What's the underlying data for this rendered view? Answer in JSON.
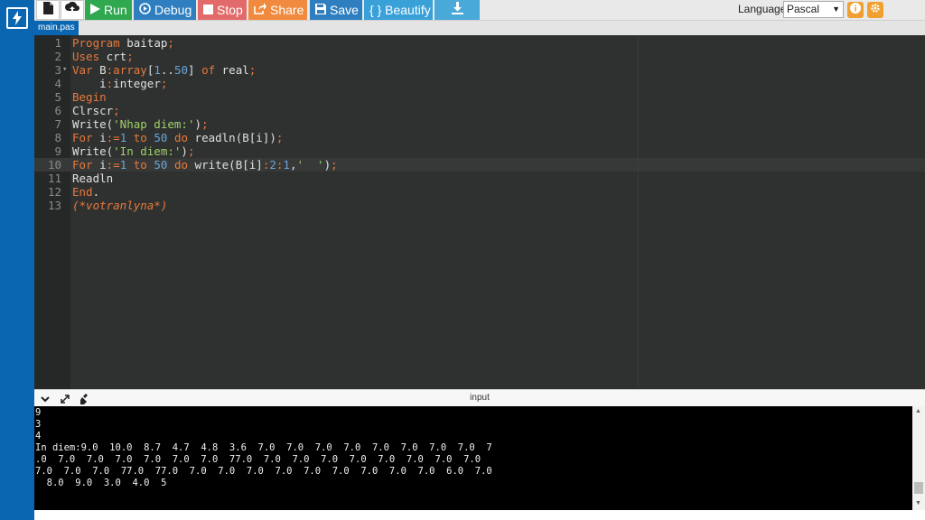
{
  "toolbar": {
    "run_label": "Run",
    "debug_label": "Debug",
    "stop_label": "Stop",
    "share_label": "Share",
    "save_label": "Save",
    "beautify_label": "{ } Beautify",
    "language_label": "Language",
    "language_value": "Pascal",
    "colors": {
      "run": "#2fa84f",
      "debug": "#2f7fc0",
      "stop": "#e36a6a",
      "share": "#f08a3e",
      "save": "#2f7fc0",
      "beautify": "#3aa0d8",
      "download": "#49a9d8",
      "round": "#f0a030"
    },
    "icons": [
      "new-file-icon",
      "upload-icon",
      "play-icon",
      "debug-icon",
      "stop-icon",
      "share-icon",
      "save-icon",
      "download-icon",
      "info-icon",
      "gear-icon"
    ]
  },
  "file_tab": "main.pas",
  "editor": {
    "active_line": 10,
    "lines": [
      {
        "n": "1",
        "fold": "",
        "html": "<span class='kw'>Program</span> baitap<span class='op'>;</span>"
      },
      {
        "n": "2",
        "fold": "",
        "html": "<span class='kw'>Uses</span> crt<span class='op'>;</span>"
      },
      {
        "n": "3",
        "fold": "▾",
        "html": "<span class='kw'>Var</span> B<span class='op'>:</span><span class='kw'>array</span>[<span class='nm'>1</span>..<span class='nm'>50</span>] <span class='kw'>of</span> real<span class='op'>;</span>"
      },
      {
        "n": "4",
        "fold": "",
        "html": "    i<span class='op'>:</span>integer<span class='op'>;</span>"
      },
      {
        "n": "5",
        "fold": "",
        "html": "<span class='kw'>Begin</span>"
      },
      {
        "n": "6",
        "fold": "",
        "html": "Clrscr<span class='op'>;</span>"
      },
      {
        "n": "7",
        "fold": "",
        "html": "Write(<span class='st'>'Nhap diem:'</span>)<span class='op'>;</span>"
      },
      {
        "n": "8",
        "fold": "",
        "html": "<span class='kw'>For</span> i<span class='op'>:=</span><span class='nm'>1</span> <span class='kw'>to</span> <span class='nm'>50</span> <span class='kw'>do</span> readln(B[i])<span class='op'>;</span>"
      },
      {
        "n": "9",
        "fold": "",
        "html": "Write(<span class='st'>'In diem:'</span>)<span class='op'>;</span>"
      },
      {
        "n": "10",
        "fold": "",
        "html": "<span class='kw'>For</span> i<span class='op'>:=</span><span class='nm'>1</span> <span class='kw'>to</span> <span class='nm'>50</span> <span class='kw'>do</span> write(B[i]<span class='op'>:</span><span class='nm'>2</span><span class='op'>:</span><span class='nm'>1</span>,<span class='st'>'  '</span>)<span class='op'>;</span>"
      },
      {
        "n": "11",
        "fold": "",
        "html": "Readln"
      },
      {
        "n": "12",
        "fold": "",
        "html": "<span class='kw'>End</span>."
      },
      {
        "n": "13",
        "fold": "",
        "html": "<span class='cm'>(*votranlyna*)</span>"
      }
    ]
  },
  "io_panel": {
    "title": "input",
    "icons": [
      "collapse-icon",
      "expand-icon",
      "clear-icon"
    ],
    "console_lines": [
      "9",
      "3",
      "4",
      "In diem:9.0  10.0  8.7  4.7  4.8  3.6  7.0  7.0  7.0  7.0  7.0  7.0  7.0  7.0  7",
      ".0  7.0  7.0  7.0  7.0  7.0  7.0  77.0  7.0  7.0  7.0  7.0  7.0  7.0  7.0  7.0",
      "7.0  7.0  7.0  77.0  77.0  7.0  7.0  7.0  7.0  7.0  7.0  7.0  7.0  7.0  6.0  7.0",
      "  8.0  9.0  3.0  4.0  5"
    ]
  }
}
